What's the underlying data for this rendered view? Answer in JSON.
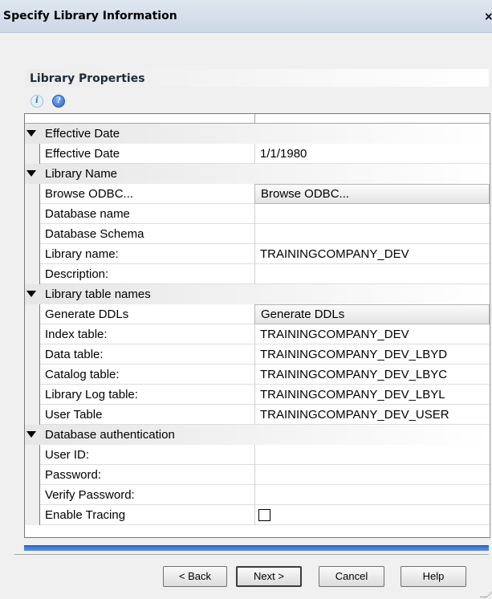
{
  "window": {
    "title": "Specify Library Information",
    "close": "×"
  },
  "section": {
    "title": "Library Properties"
  },
  "icons": {
    "info": "i",
    "help": "?"
  },
  "grid": {
    "effective_date": {
      "category": "Effective Date",
      "rows": {
        "effective_date": {
          "name": "Effective Date",
          "value": "1/1/1980"
        }
      }
    },
    "library_name": {
      "category": "Library Name",
      "browse": {
        "name": "Browse ODBC...",
        "button": "Browse ODBC..."
      },
      "database_name": {
        "name": "Database name",
        "value": ""
      },
      "database_schema": {
        "name": "Database Schema",
        "value": ""
      },
      "library_name": {
        "name": "Library name:",
        "value": "TRAININGCOMPANY_DEV"
      },
      "description": {
        "name": "Description:",
        "value": ""
      }
    },
    "table_names": {
      "category": "Library table names",
      "generate": {
        "name": "Generate DDLs",
        "button": "Generate DDLs"
      },
      "index": {
        "name": "Index table:",
        "value": "TRAININGCOMPANY_DEV"
      },
      "data": {
        "name": "Data table:",
        "value": "TRAININGCOMPANY_DEV_LBYD"
      },
      "catalog": {
        "name": "Catalog table:",
        "value": "TRAININGCOMPANY_DEV_LBYC"
      },
      "log": {
        "name": "Library Log table:",
        "value": "TRAININGCOMPANY_DEV_LBYL"
      },
      "user": {
        "name": "User Table",
        "value": "TRAININGCOMPANY_DEV_USER"
      }
    },
    "auth": {
      "category": "Database authentication",
      "user_id": {
        "name": "User ID:",
        "value": ""
      },
      "password": {
        "name": "Password:",
        "value": ""
      },
      "verify": {
        "name": "Verify Password:",
        "value": ""
      },
      "tracing": {
        "name": "Enable Tracing",
        "checked": false
      }
    }
  },
  "buttons": {
    "back": "< Back",
    "next": "Next >",
    "cancel": "Cancel",
    "help": "Help"
  }
}
